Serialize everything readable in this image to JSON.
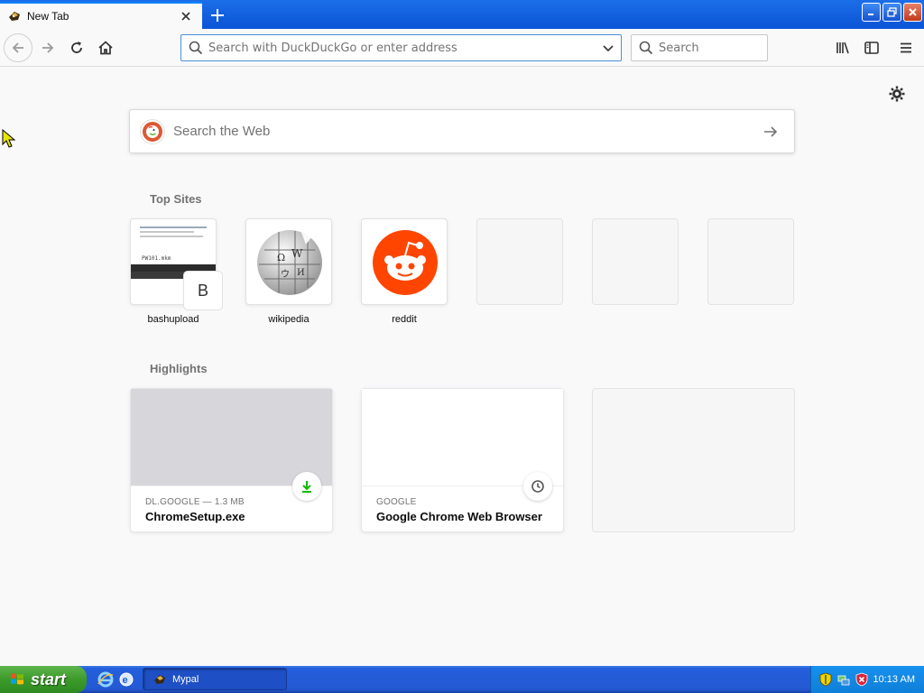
{
  "tab": {
    "title": "New Tab",
    "close_icon": "close-icon"
  },
  "toolbar": {
    "url_placeholder": "Search with DuckDuckGo or enter address",
    "search_placeholder": "Search"
  },
  "page": {
    "web_search_placeholder": "Search the Web",
    "top_sites_title": "Top Sites",
    "top_sites": [
      {
        "label": "bashupload",
        "badge_letter": "B",
        "thumb_text": "PW101.mkm"
      },
      {
        "label": "wikipedia"
      },
      {
        "label": "reddit"
      }
    ],
    "highlights_title": "Highlights",
    "highlights": [
      {
        "source": "DL.GOOGLE — 1.3 MB",
        "name": "ChromeSetup.exe",
        "icon": "download-icon"
      },
      {
        "source": "GOOGLE",
        "name": "Google Chrome Web Browser",
        "icon": "clock-icon"
      }
    ]
  },
  "taskbar": {
    "start_label": "start",
    "window_label": "Mypal",
    "clock": "10:13 AM"
  },
  "colors": {
    "titlebar": "#0a54d6",
    "accent": "#0a84ff",
    "reddit": "#ff4500",
    "ddg": "#de5833",
    "download_green": "#12bc00"
  }
}
